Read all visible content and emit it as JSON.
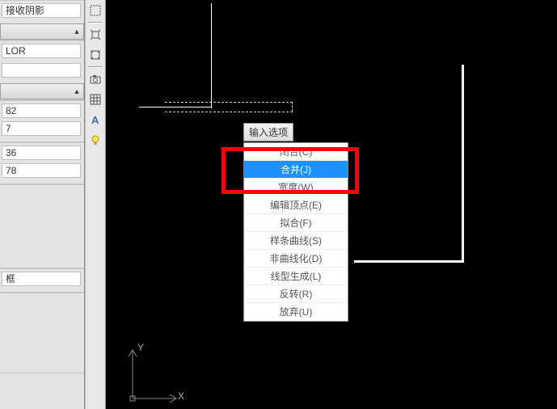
{
  "colors": {
    "accent": "#1e90ff",
    "annotation": "#ff0000"
  },
  "left": {
    "section0": {
      "field0": "接收阴影"
    },
    "section1": {
      "field0": "LOR"
    },
    "section2": {
      "field0": "82",
      "field1": "7"
    },
    "section3": {
      "field0": "36",
      "field1": "78"
    },
    "section4": {
      "field0": "框"
    }
  },
  "tools": [
    "outline-dashed-icon",
    "crop-stretch-icon",
    "crop-shrink-icon",
    "camera-icon",
    "grid-icon",
    "text-a-icon",
    "light-icon"
  ],
  "tooltip": "输入选项",
  "menu": {
    "items": [
      {
        "label": "闭合(C)"
      },
      {
        "label": "合并(J)",
        "highlight": true
      },
      {
        "label": "宽度(W)"
      },
      {
        "label": "编辑顶点(E)"
      },
      {
        "label": "拟合(F)"
      },
      {
        "label": "样条曲线(S)"
      },
      {
        "label": "非曲线化(D)"
      },
      {
        "label": "线型生成(L)"
      },
      {
        "label": "反转(R)"
      },
      {
        "label": "放弃(U)"
      }
    ]
  },
  "ucs": {
    "x": "X",
    "y": "Y"
  }
}
